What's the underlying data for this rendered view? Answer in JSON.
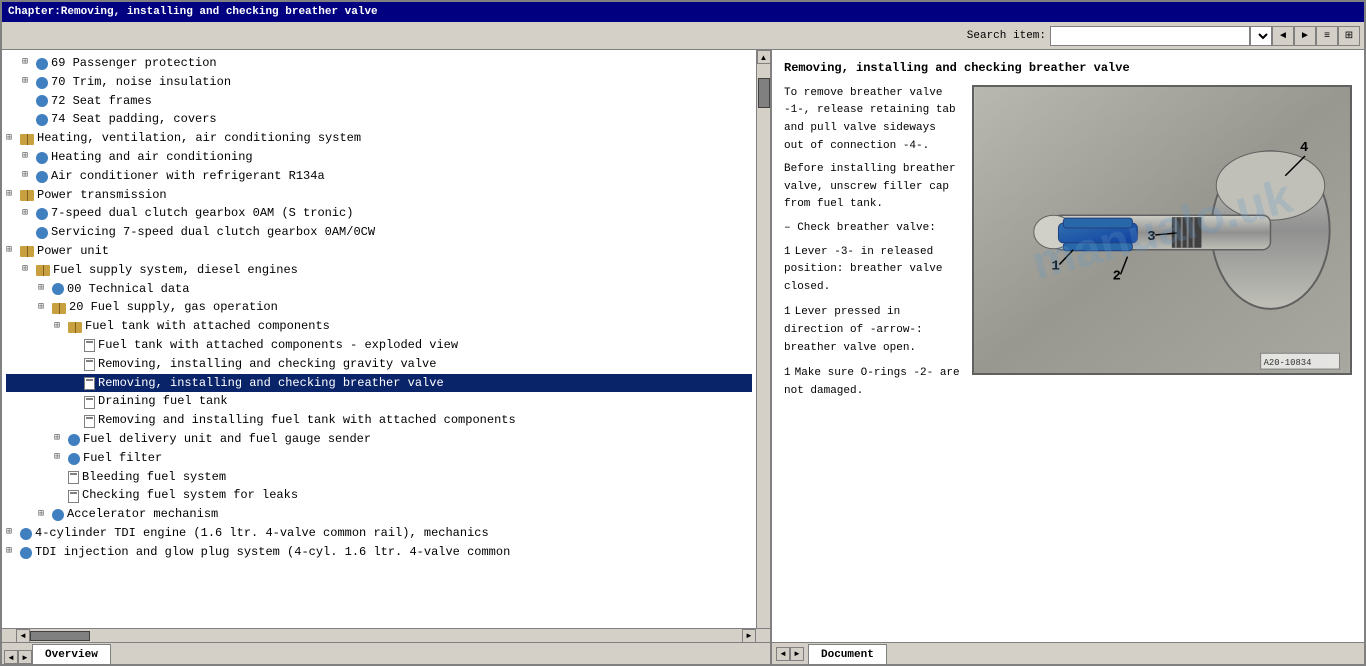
{
  "titleBar": {
    "title": "Chapter:Removing, installing and checking breather valve"
  },
  "toolbar": {
    "searchLabel": "Search item:",
    "searchPlaceholder": "",
    "searchValue": ""
  },
  "tree": {
    "items": [
      {
        "id": 1,
        "indent": 2,
        "type": "diamond",
        "expandable": true,
        "text": "69 Passenger protection"
      },
      {
        "id": 2,
        "indent": 2,
        "type": "diamond",
        "expandable": true,
        "text": "70 Trim, noise insulation"
      },
      {
        "id": 3,
        "indent": 2,
        "type": "diamond",
        "expandable": false,
        "text": "72 Seat frames"
      },
      {
        "id": 4,
        "indent": 2,
        "type": "diamond",
        "expandable": false,
        "text": "74 Seat padding, covers"
      },
      {
        "id": 5,
        "indent": 1,
        "type": "book",
        "expandable": true,
        "text": "Heating, ventilation, air conditioning system"
      },
      {
        "id": 6,
        "indent": 2,
        "type": "diamond",
        "expandable": true,
        "text": "Heating and air conditioning"
      },
      {
        "id": 7,
        "indent": 2,
        "type": "diamond",
        "expandable": true,
        "text": "Air conditioner with refrigerant R134a"
      },
      {
        "id": 8,
        "indent": 1,
        "type": "book",
        "expandable": true,
        "text": "Power transmission"
      },
      {
        "id": 9,
        "indent": 2,
        "type": "diamond",
        "expandable": true,
        "text": "7-speed dual clutch gearbox 0AM (S tronic)"
      },
      {
        "id": 10,
        "indent": 2,
        "type": "diamond",
        "expandable": false,
        "text": "Servicing 7-speed dual clutch gearbox 0AM/0CW"
      },
      {
        "id": 11,
        "indent": 1,
        "type": "book",
        "expandable": true,
        "text": "Power unit"
      },
      {
        "id": 12,
        "indent": 2,
        "type": "book",
        "expandable": true,
        "text": "Fuel supply system, diesel engines"
      },
      {
        "id": 13,
        "indent": 3,
        "type": "diamond",
        "expandable": true,
        "text": "00 Technical data"
      },
      {
        "id": 14,
        "indent": 3,
        "type": "book",
        "expandable": true,
        "text": "20 Fuel supply, gas operation"
      },
      {
        "id": 15,
        "indent": 4,
        "type": "book",
        "expandable": true,
        "text": "Fuel tank with attached components"
      },
      {
        "id": 16,
        "indent": 5,
        "type": "page",
        "expandable": false,
        "text": "Fuel tank with attached components - exploded view"
      },
      {
        "id": 17,
        "indent": 5,
        "type": "page",
        "expandable": false,
        "text": "Removing, installing and checking gravity valve"
      },
      {
        "id": 18,
        "indent": 5,
        "type": "page",
        "expandable": false,
        "text": "Removing, installing and checking breather valve",
        "selected": true
      },
      {
        "id": 19,
        "indent": 5,
        "type": "page",
        "expandable": false,
        "text": "Draining fuel tank"
      },
      {
        "id": 20,
        "indent": 5,
        "type": "page",
        "expandable": false,
        "text": "Removing and installing fuel tank with attached components"
      },
      {
        "id": 21,
        "indent": 4,
        "type": "diamond",
        "expandable": true,
        "text": "Fuel delivery unit and fuel gauge sender"
      },
      {
        "id": 22,
        "indent": 4,
        "type": "diamond",
        "expandable": true,
        "text": "Fuel filter"
      },
      {
        "id": 23,
        "indent": 4,
        "type": "page",
        "expandable": false,
        "text": "Bleeding fuel system"
      },
      {
        "id": 24,
        "indent": 4,
        "type": "page",
        "expandable": false,
        "text": "Checking fuel system for leaks"
      },
      {
        "id": 25,
        "indent": 3,
        "type": "diamond",
        "expandable": true,
        "text": "Accelerator mechanism"
      },
      {
        "id": 26,
        "indent": 1,
        "type": "diamond",
        "expandable": true,
        "text": "4-cylinder TDI engine (1.6 ltr. 4-valve common rail), mechanics"
      },
      {
        "id": 27,
        "indent": 1,
        "type": "diamond",
        "expandable": true,
        "text": "TDI injection and glow plug system (4-cyl. 1.6 ltr. 4-valve common"
      }
    ]
  },
  "document": {
    "title": "Removing, installing and checking breather valve",
    "sections": [
      {
        "text": "To remove breather valve -1-, release retaining tab and pull valve sideways out of connection -4-."
      },
      {
        "text": "Before installing breather valve, unscrew filler cap from fuel tank."
      },
      {
        "prefix": "–",
        "text": "Check breather valve:"
      },
      {
        "prefix": "1",
        "text": "Lever -3- in released position: breather valve closed."
      },
      {
        "prefix": "1",
        "text": "Lever pressed in direction of -arrow-: breather valve open."
      },
      {
        "prefix": "1",
        "text": "Make sure O-rings -2- are not damaged."
      }
    ],
    "imageRef": "A20-10834",
    "imageNumbers": [
      "1",
      "2",
      "3",
      "4"
    ],
    "watermark": "manualo.uk"
  },
  "tabs": {
    "left": {
      "label": "Overview"
    },
    "right": {
      "label": "Document"
    }
  },
  "icons": {
    "expand": "+",
    "collapse": "-",
    "arrowLeft": "◄",
    "arrowRight": "►",
    "arrowUp": "▲",
    "arrowDown": "▼",
    "search": "🔍"
  }
}
